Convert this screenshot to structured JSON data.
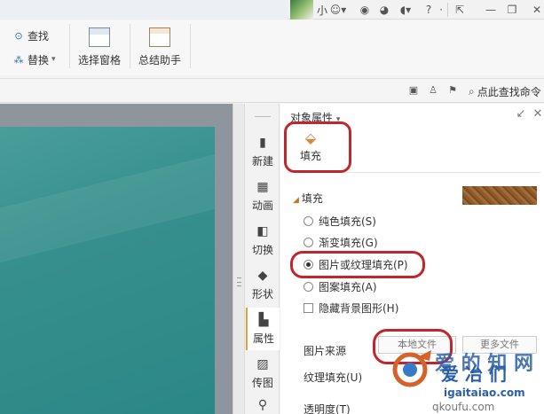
{
  "titlebar": {
    "user_name": "小",
    "help_icon_label": "?"
  },
  "ribbon": {
    "find_label": "查找",
    "replace_label": "替换",
    "select_pane_label": "选择窗格",
    "summary_assistant_label": "总结助手"
  },
  "subbar": {
    "search_label": "点此查找命令"
  },
  "rail": {
    "items": [
      {
        "label": "新建"
      },
      {
        "label": "动画"
      },
      {
        "label": "切换"
      },
      {
        "label": "形状"
      },
      {
        "label": "属性"
      },
      {
        "label": "传图"
      }
    ]
  },
  "pane": {
    "title": "对象属性",
    "fill_tab_label": "填充",
    "section_title": "填充",
    "options": {
      "solid": "纯色填充(S)",
      "gradient": "渐变填充(G)",
      "picture": "图片或纹理填充(P)",
      "pattern": "图案填充(A)",
      "hide_bg": "隐藏背景图形(H)"
    },
    "picture_source_label": "图片来源",
    "source_button_label": "本地文件",
    "source_button2_label": "更多文件",
    "texture_fill_label": "纹理填充(U)",
    "transparency_label": "透明度(T)"
  },
  "watermark": {
    "line1": "爱 的 知 网",
    "line2": "爱 冶 们",
    "line3": "igaitaiao.com",
    "line4": "qkoufu.com"
  },
  "colors": {
    "accent": "#e0a03a",
    "highlight": "#c0262c",
    "slide": "#37908d"
  }
}
